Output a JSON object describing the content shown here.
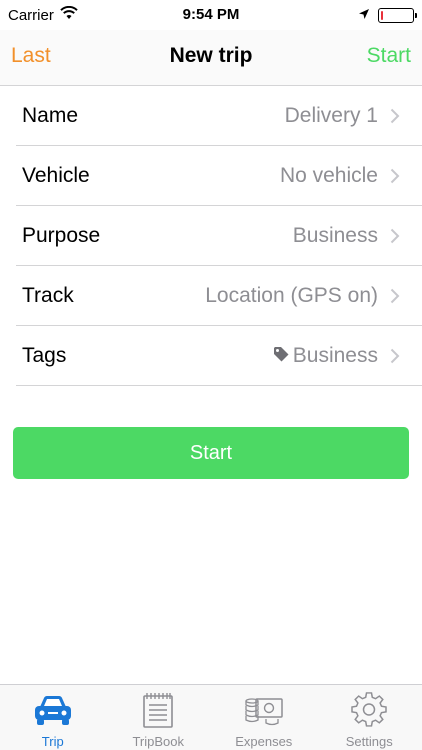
{
  "status_bar": {
    "carrier": "Carrier",
    "time": "9:54 PM",
    "battery_level": 0.08,
    "icons": [
      "wifi-icon",
      "location-arrow-icon",
      "battery-icon"
    ]
  },
  "nav": {
    "left_label": "Last",
    "title": "New trip",
    "right_label": "Start",
    "left_color": "#f2902a",
    "right_color": "#4cd964"
  },
  "form": {
    "rows": [
      {
        "label": "Name",
        "value": "Delivery 1"
      },
      {
        "label": "Vehicle",
        "value": "No vehicle"
      },
      {
        "label": "Purpose",
        "value": "Business"
      },
      {
        "label": "Track",
        "value": "Location (GPS on)"
      },
      {
        "label": "Tags",
        "value": "Business",
        "icon": "tag-icon"
      }
    ]
  },
  "start_button": {
    "label": "Start",
    "color": "#4cd964"
  },
  "tabs": [
    {
      "label": "Trip",
      "icon": "car-icon",
      "active": true
    },
    {
      "label": "TripBook",
      "icon": "notebook-icon",
      "active": false
    },
    {
      "label": "Expenses",
      "icon": "expenses-icon",
      "active": false
    },
    {
      "label": "Settings",
      "icon": "gear-icon",
      "active": false
    }
  ],
  "colors": {
    "active_tab": "#1b78d6",
    "inactive_tab": "#8e8e93"
  }
}
